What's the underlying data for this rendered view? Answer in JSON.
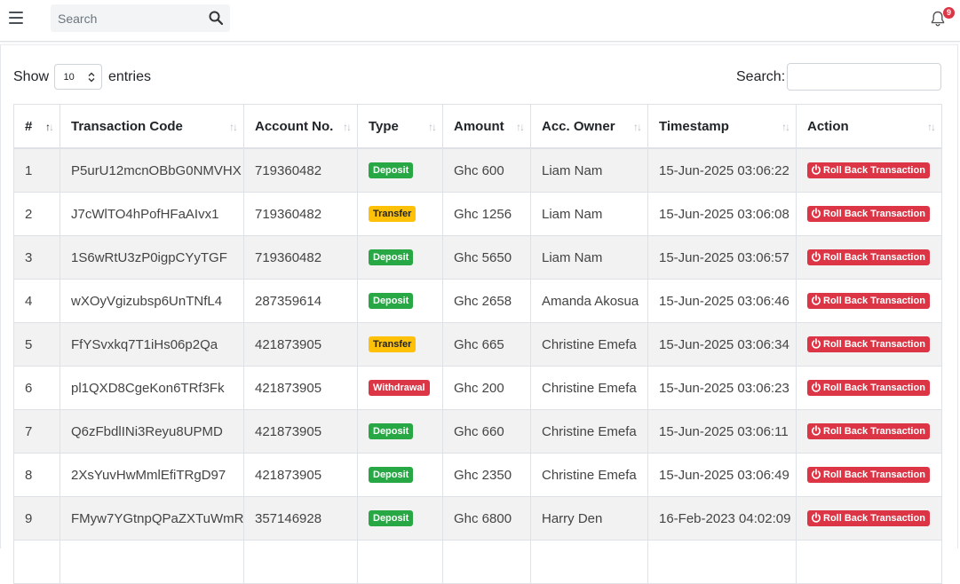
{
  "topbar": {
    "menu_icon": "hamburger-icon",
    "search_placeholder": "Search",
    "search_icon": "search-icon",
    "bell_icon": "bell-icon",
    "notification_count": "9"
  },
  "table_controls": {
    "show_label": "Show",
    "entries_value": "10",
    "entries_label": "entries",
    "search_label": "Search:"
  },
  "columns": [
    "#",
    "Transaction Code",
    "Account No.",
    "Type",
    "Amount",
    "Acc. Owner",
    "Timestamp",
    "Action"
  ],
  "rows": [
    {
      "num": "1",
      "code": "P5urU12mcnOBbG0NMVHX",
      "account": "719360482",
      "type": "Deposit",
      "type_class": "deposit",
      "amount": "Ghc 600",
      "owner": "Liam Nam",
      "timestamp": "15-Jun-2025 03:06:22",
      "action": "Roll Back Transaction"
    },
    {
      "num": "2",
      "code": "J7cWlTO4hPofHFaAIvx1",
      "account": "719360482",
      "type": "Transfer",
      "type_class": "transfer",
      "amount": "Ghc 1256",
      "owner": "Liam Nam",
      "timestamp": "15-Jun-2025 03:06:08",
      "action": "Roll Back Transaction"
    },
    {
      "num": "3",
      "code": "1S6wRtU3zP0igpCYyTGF",
      "account": "719360482",
      "type": "Deposit",
      "type_class": "deposit",
      "amount": "Ghc 5650",
      "owner": "Liam Nam",
      "timestamp": "15-Jun-2025 03:06:57",
      "action": "Roll Back Transaction"
    },
    {
      "num": "4",
      "code": "wXOyVgizubsp6UnTNfL4",
      "account": "287359614",
      "type": "Deposit",
      "type_class": "deposit",
      "amount": "Ghc 2658",
      "owner": "Amanda Akosua",
      "timestamp": "15-Jun-2025 03:06:46",
      "action": "Roll Back Transaction"
    },
    {
      "num": "5",
      "code": "FfYSvxkq7T1iHs06p2Qa",
      "account": "421873905",
      "type": "Transfer",
      "type_class": "transfer",
      "amount": "Ghc 665",
      "owner": "Christine Emefa",
      "timestamp": "15-Jun-2025 03:06:34",
      "action": "Roll Back Transaction"
    },
    {
      "num": "6",
      "code": "pl1QXD8CgeKon6TRf3Fk",
      "account": "421873905",
      "type": "Withdrawal",
      "type_class": "withdrawal",
      "amount": "Ghc 200",
      "owner": "Christine Emefa",
      "timestamp": "15-Jun-2025 03:06:23",
      "action": "Roll Back Transaction"
    },
    {
      "num": "7",
      "code": "Q6zFbdlINi3Reyu8UPMD",
      "account": "421873905",
      "type": "Deposit",
      "type_class": "deposit",
      "amount": "Ghc 660",
      "owner": "Christine Emefa",
      "timestamp": "15-Jun-2025 03:06:11",
      "action": "Roll Back Transaction"
    },
    {
      "num": "8",
      "code": "2XsYuvHwMmlEfiTRgD97",
      "account": "421873905",
      "type": "Deposit",
      "type_class": "deposit",
      "amount": "Ghc 2350",
      "owner": "Christine Emefa",
      "timestamp": "15-Jun-2025 03:06:49",
      "action": "Roll Back Transaction"
    },
    {
      "num": "9",
      "code": "FMyw7YGtnpQPaZXTuWmR",
      "account": "357146928",
      "type": "Deposit",
      "type_class": "deposit",
      "amount": "Ghc 6800",
      "owner": "Harry Den",
      "timestamp": "16-Feb-2023 04:02:09",
      "action": "Roll Back Transaction"
    },
    {
      "num": "",
      "code": "",
      "account": "",
      "type": "",
      "type_class": "",
      "amount": "",
      "owner": "",
      "timestamp": "",
      "action": ""
    }
  ],
  "colors": {
    "deposit": "#28a745",
    "transfer": "#ffc107",
    "withdrawal": "#dc3545",
    "rollback": "#dc3545"
  }
}
